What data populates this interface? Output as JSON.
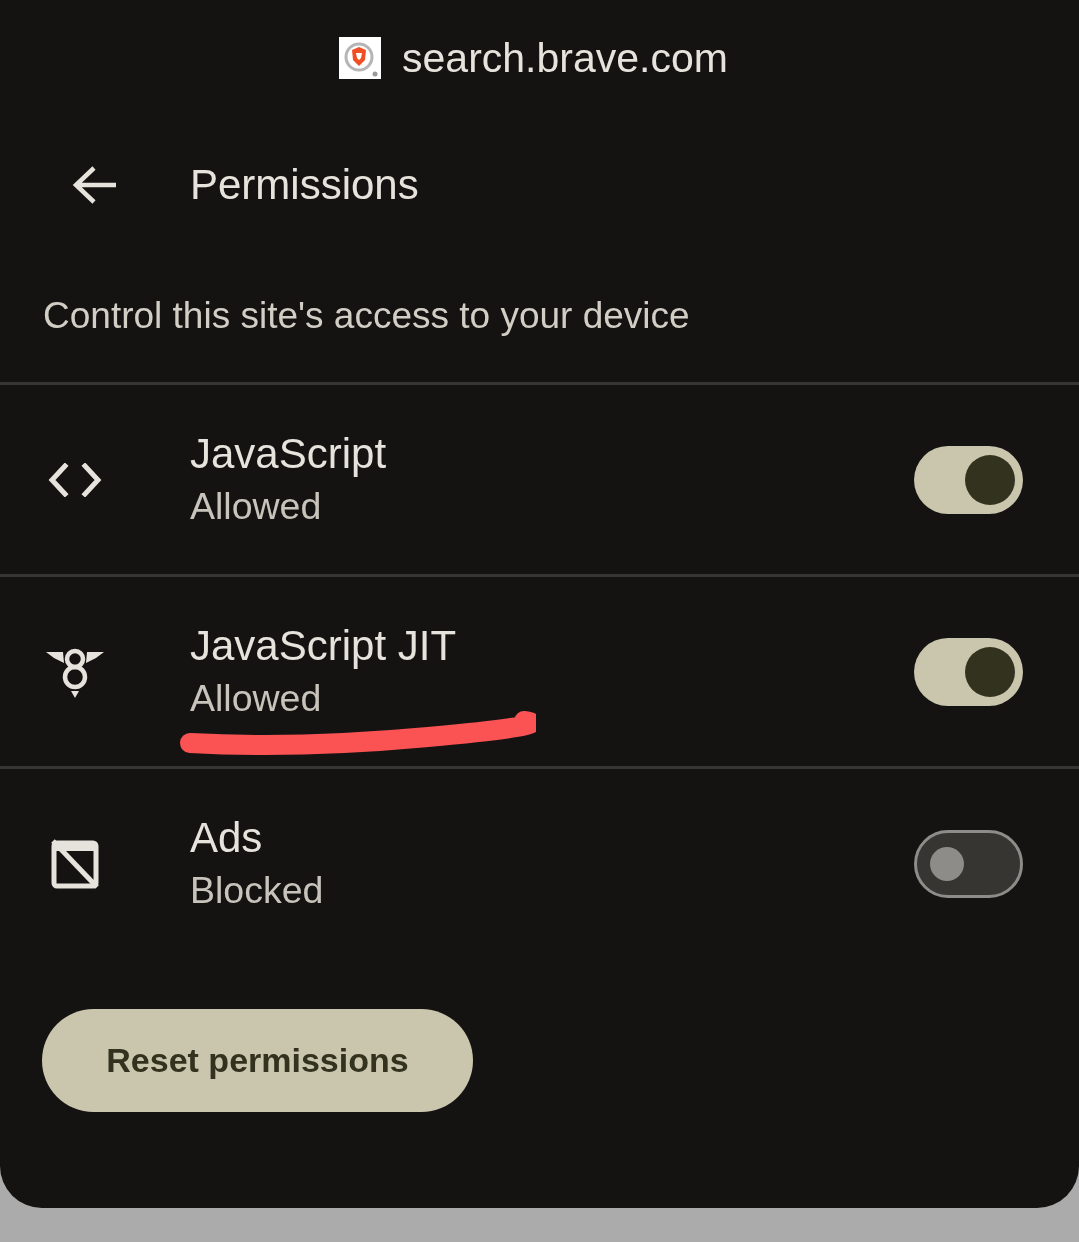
{
  "header": {
    "site": "search.brave.com"
  },
  "toolbar": {
    "title": "Permissions"
  },
  "description": "Control this site's access to your device",
  "permissions": [
    {
      "kind": "code",
      "name": "JavaScript",
      "status": "Allowed",
      "on": true,
      "underlined": false
    },
    {
      "kind": "engine",
      "name": "JavaScript JIT",
      "status": "Allowed",
      "on": true,
      "underlined": true
    },
    {
      "kind": "ads",
      "name": "Ads",
      "status": "Blocked",
      "on": false,
      "underlined": false
    }
  ],
  "reset_button": {
    "label": "Reset permissions"
  }
}
